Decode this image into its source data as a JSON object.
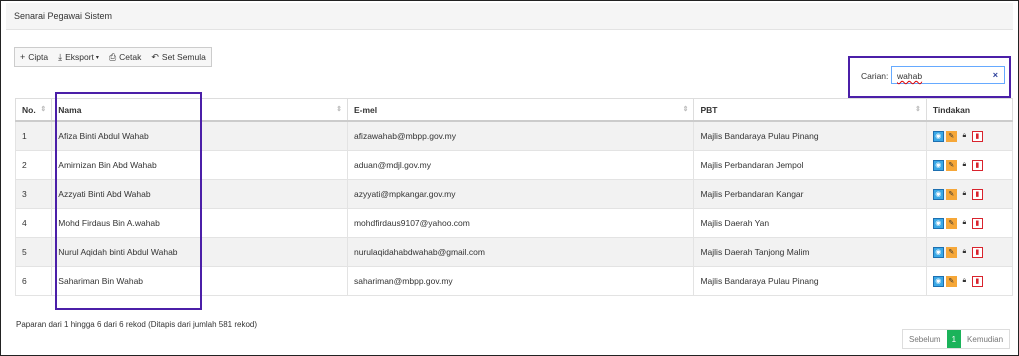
{
  "panel": {
    "title": "Senarai Pegawai Sistem"
  },
  "toolbar": {
    "create": "Cipta",
    "export": "Eksport",
    "print": "Cetak",
    "reset": "Set Semula"
  },
  "search": {
    "label": "Carian:",
    "value": "wahab",
    "clear": "×"
  },
  "table": {
    "headers": {
      "no": "No.",
      "nama": "Nama",
      "email": "E-mel",
      "pbt": "PBT",
      "actions": "Tindakan"
    },
    "rows": [
      {
        "no": "1",
        "nama": "Afiza Binti Abdul Wahab",
        "email": "afizawahab@mbpp.gov.my",
        "pbt": "Majlis Bandaraya Pulau Pinang"
      },
      {
        "no": "2",
        "nama": "Amirnizan Bin Abd Wahab",
        "email": "aduan@mdjl.gov.my",
        "pbt": "Majlis Perbandaran Jempol"
      },
      {
        "no": "3",
        "nama": "Azzyati Binti Abd Wahab",
        "email": "azyyati@mpkangar.gov.my",
        "pbt": "Majlis Perbandaran Kangar"
      },
      {
        "no": "4",
        "nama": "Mohd Firdaus Bin A.wahab",
        "email": "mohdfirdaus9107@yahoo.com",
        "pbt": "Majlis Daerah Yan"
      },
      {
        "no": "5",
        "nama": "Nurul Aqidah binti Abdul Wahab",
        "email": "nurulaqidahabdwahab@gmail.com",
        "pbt": "Majlis Daerah Tanjong Malim"
      },
      {
        "no": "6",
        "nama": "Sahariman Bin Wahab",
        "email": "sahariman@mbpp.gov.my",
        "pbt": "Majlis Bandaraya Pulau Pinang"
      }
    ]
  },
  "info": "Paparan dari 1 hingga 6 dari 6 rekod (Ditapis dari jumlah 581 rekod)",
  "pagination": {
    "prev": "Sebelum",
    "current": "1",
    "next": "Kemudian"
  },
  "colors": {
    "accent_highlight": "#4b1fa8",
    "view": "#3aa8e6",
    "edit": "#f6a738",
    "delete": "#d9232d",
    "page_active": "#1bb35a"
  },
  "icons": {
    "create": "plus-icon",
    "export": "download-icon",
    "print": "print-icon",
    "reset": "undo-icon",
    "view": "eye-icon",
    "edit": "pencil-icon",
    "lock": "lock-icon",
    "delete": "trash-icon"
  }
}
